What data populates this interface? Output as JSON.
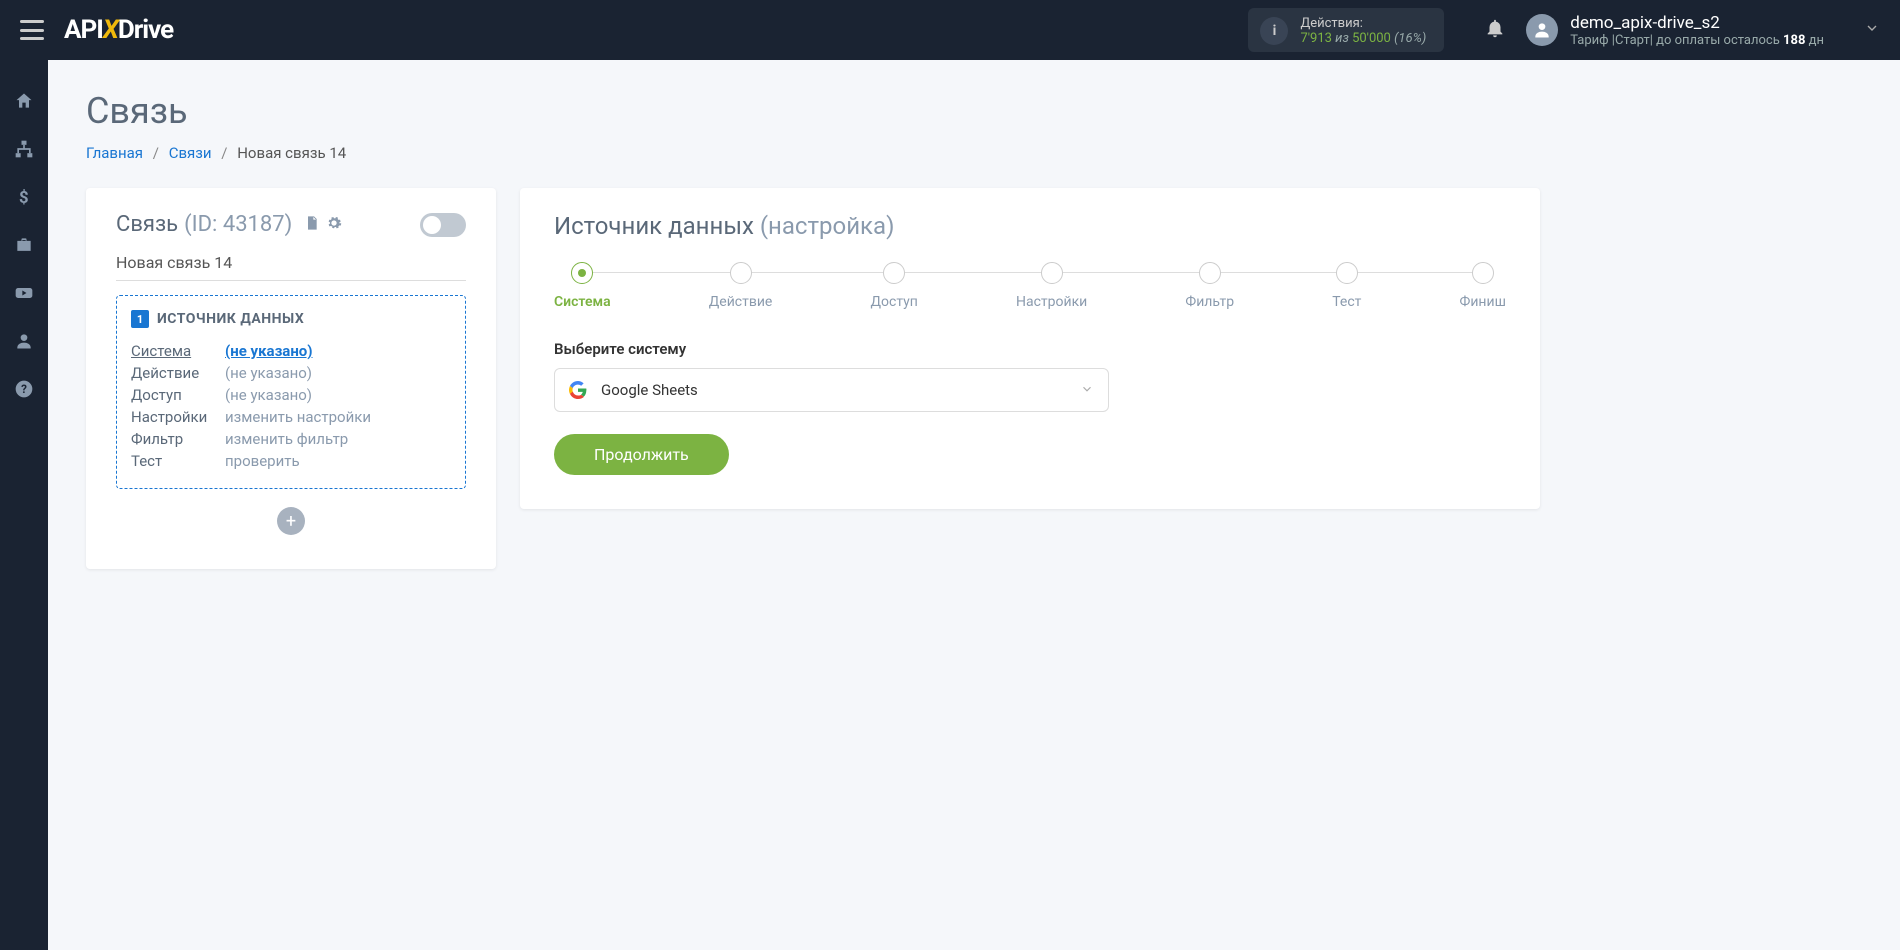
{
  "header": {
    "actions_label": "Действия:",
    "actions_used": "7'913",
    "actions_of": "из",
    "actions_total": "50'000",
    "actions_pct": "(16%)",
    "user_name": "demo_apix-drive_s2",
    "plan_prefix": "Тариф |Старт| до оплаты осталось ",
    "plan_days": "188",
    "plan_suffix": " дн"
  },
  "page": {
    "title": "Связь",
    "breadcrumb": {
      "home": "Главная",
      "connections": "Связи",
      "current": "Новая связь 14"
    }
  },
  "left": {
    "title": "Связь",
    "id_label": "(ID: 43187)",
    "connection_name": "Новая связь 14",
    "source_badge": "1",
    "source_title": "ИСТОЧНИК ДАННЫХ",
    "rows": [
      {
        "label": "Система",
        "value": "(не указано)",
        "warn": true,
        "activeLabel": true
      },
      {
        "label": "Действие",
        "value": "(не указано)"
      },
      {
        "label": "Доступ",
        "value": "(не указано)"
      },
      {
        "label": "Настройки",
        "value": "изменить настройки"
      },
      {
        "label": "Фильтр",
        "value": "изменить фильтр"
      },
      {
        "label": "Тест",
        "value": "проверить"
      }
    ]
  },
  "right": {
    "title_main": "Источник данных",
    "title_sub": "(настройка)",
    "steps": [
      "Система",
      "Действие",
      "Доступ",
      "Настройки",
      "Фильтр",
      "Тест",
      "Финиш"
    ],
    "active_step": 0,
    "field_label": "Выберите систему",
    "select_value": "Google Sheets",
    "continue_label": "Продолжить"
  }
}
